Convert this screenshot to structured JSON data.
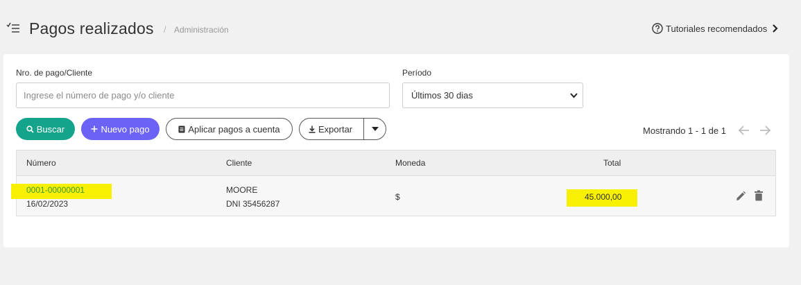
{
  "header": {
    "title": "Pagos realizados",
    "breadcrumb_sep": "/",
    "breadcrumb": "Administración",
    "tutorials": "Tutoriales recomendados"
  },
  "filters": {
    "number_label": "Nro. de pago/Cliente",
    "number_placeholder": "Ingrese el número de pago y/o cliente",
    "number_value": "",
    "period_label": "Período",
    "period_value": "Últimos 30 dias"
  },
  "actions": {
    "search": "Buscar",
    "new_payment": "Nuevo pago",
    "apply_payments": "Aplicar pagos a cuenta",
    "export": "Exportar"
  },
  "paging": {
    "text": "Mostrando 1 - 1 de 1"
  },
  "table": {
    "headers": [
      "Número",
      "Cliente",
      "Moneda",
      "Total"
    ],
    "rows": [
      {
        "number": "0001-00000001",
        "date": "16/02/2023",
        "client": "MOORE",
        "client_doc": "DNI 35456287",
        "currency": "$",
        "total": "45.000,00"
      }
    ]
  },
  "colors": {
    "search_button": "#14a38b",
    "new_button": "#6c63f6",
    "highlight": "#f7f002",
    "link": "#3a9a2f"
  },
  "icons": [
    "menu-icon",
    "help-circle-icon",
    "chevron-right-icon",
    "search-icon",
    "plus-icon",
    "document-icon",
    "download-icon",
    "caret-down-icon",
    "arrow-left-icon",
    "arrow-right-icon",
    "pencil-icon",
    "trash-icon"
  ]
}
